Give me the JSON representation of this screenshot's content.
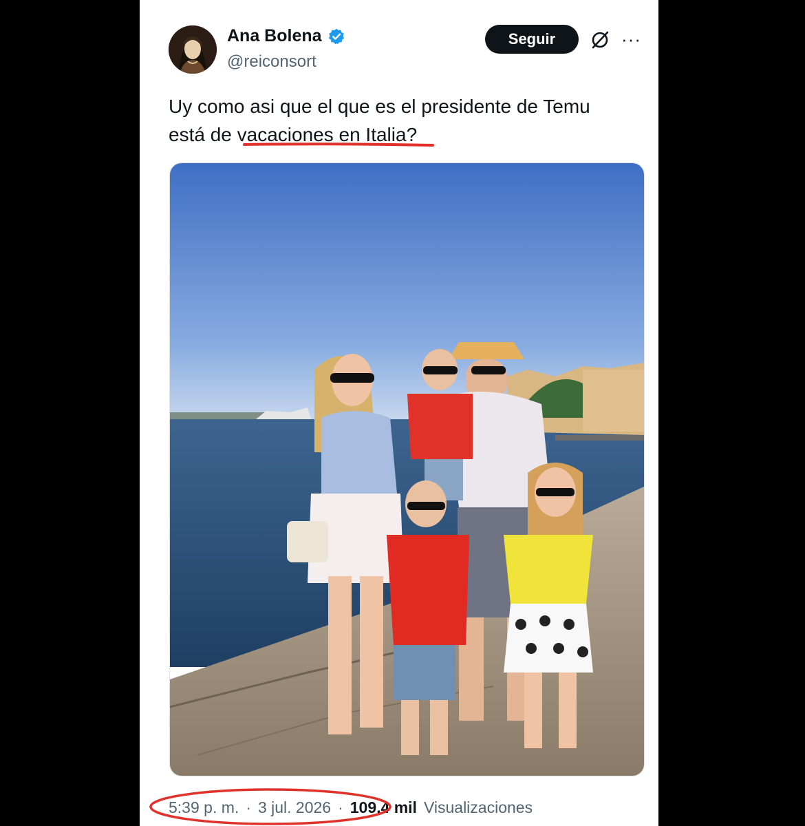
{
  "tweet": {
    "display_name": "Ana Bolena",
    "handle": "@reiconsort",
    "follow_label": "Seguir",
    "more_label": "···",
    "text_line1": "Uy como asi que el que es el presidente de Temu",
    "text_line2_prefix": "está de ",
    "text_line2_highlight": "vacaciones en Italia",
    "text_line2_suffix": "?",
    "time": "5:39 p. m.",
    "separator": "·",
    "date": "3 jul. 2026",
    "views_count": "109,4 mil",
    "views_label": "Visualizaciones"
  },
  "icons": {
    "verified": "verified-badge-icon",
    "grok": "grok-icon",
    "more": "more-options-icon"
  },
  "colors": {
    "verified_blue": "#1d9bf0",
    "annotation_red": "#e0322b",
    "follow_bg": "#0f1419"
  }
}
